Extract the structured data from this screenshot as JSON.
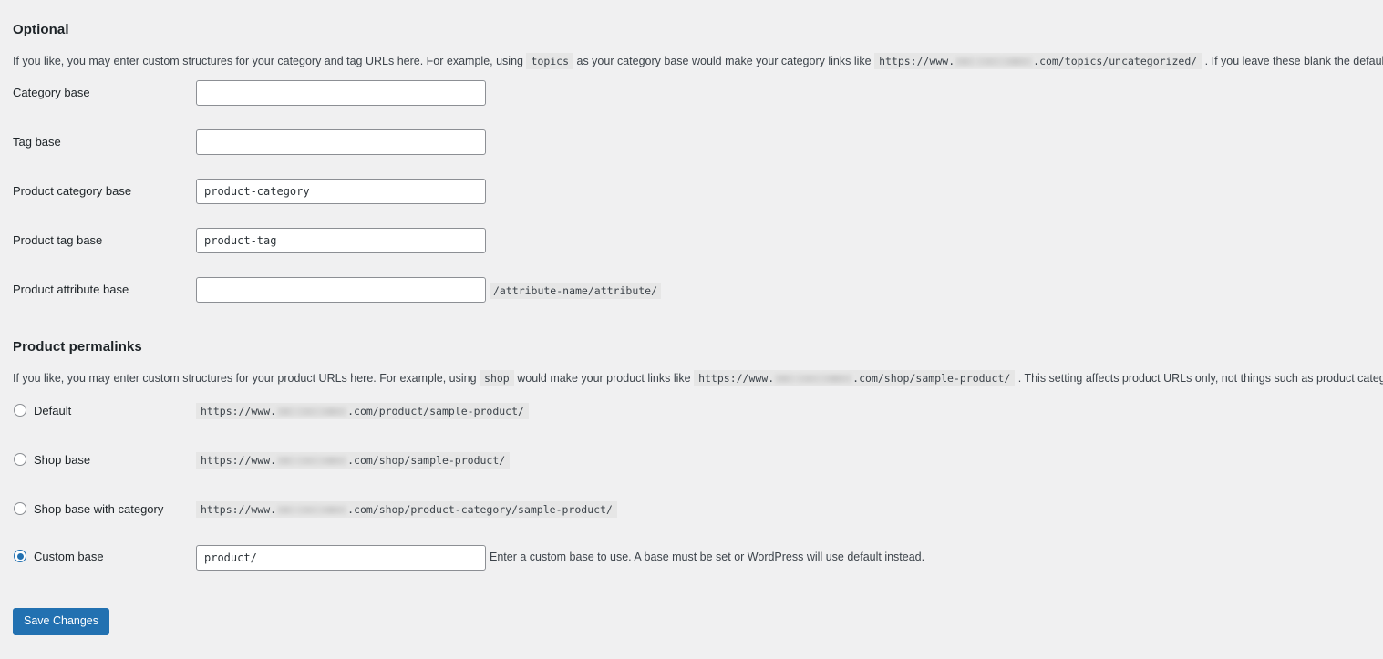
{
  "sections": {
    "optional": {
      "heading": "Optional",
      "description": {
        "part1": "If you like, you may enter custom structures for your category and tag URLs here. For example, using",
        "code1": "topics",
        "part2": "as your category base would make your category links like",
        "code2_prefix": "https://www.",
        "code2_suffix": ".com/topics/uncategorized/",
        "part3": ". If you leave these blank the defaults will be used."
      }
    },
    "product_permalinks": {
      "heading": "Product permalinks",
      "description": {
        "part1": "If you like, you may enter custom structures for your product URLs here. For example, using",
        "code1": "shop",
        "part2": "would make your product links like",
        "code2_prefix": "https://www.",
        "code2_suffix": ".com/shop/sample-product/",
        "part3": ". This setting affects product URLs only, not things such as product categories."
      }
    }
  },
  "fields": [
    {
      "label": "Category base",
      "value": "",
      "suffix": ""
    },
    {
      "label": "Tag base",
      "value": "",
      "suffix": ""
    },
    {
      "label": "Product category base",
      "value": "product-category",
      "suffix": ""
    },
    {
      "label": "Product tag base",
      "value": "product-tag",
      "suffix": ""
    },
    {
      "label": "Product attribute base",
      "value": "",
      "suffix": "/attribute-name/attribute/"
    }
  ],
  "permalink_options": [
    {
      "label": "Default",
      "selected": false,
      "example_prefix": "https://www.",
      "example_suffix": ".com/product/sample-product/"
    },
    {
      "label": "Shop base",
      "selected": false,
      "example_prefix": "https://www.",
      "example_suffix": ".com/shop/sample-product/"
    },
    {
      "label": "Shop base with category",
      "selected": false,
      "example_prefix": "https://www.",
      "example_suffix": ".com/shop/product-category/sample-product/"
    },
    {
      "label": "Custom base",
      "selected": true,
      "input_value": "product/",
      "help": "Enter a custom base to use. A base must be set or WordPress will use default instead."
    }
  ],
  "save_button": {
    "label": "Save Changes"
  },
  "colors": {
    "page_background": "#f0f0f1",
    "accent": "#2271b1",
    "label_text": "#1d2327",
    "body_text": "#3c434a",
    "input_border": "#8c8f94",
    "code_background": "#e6e6e6"
  }
}
